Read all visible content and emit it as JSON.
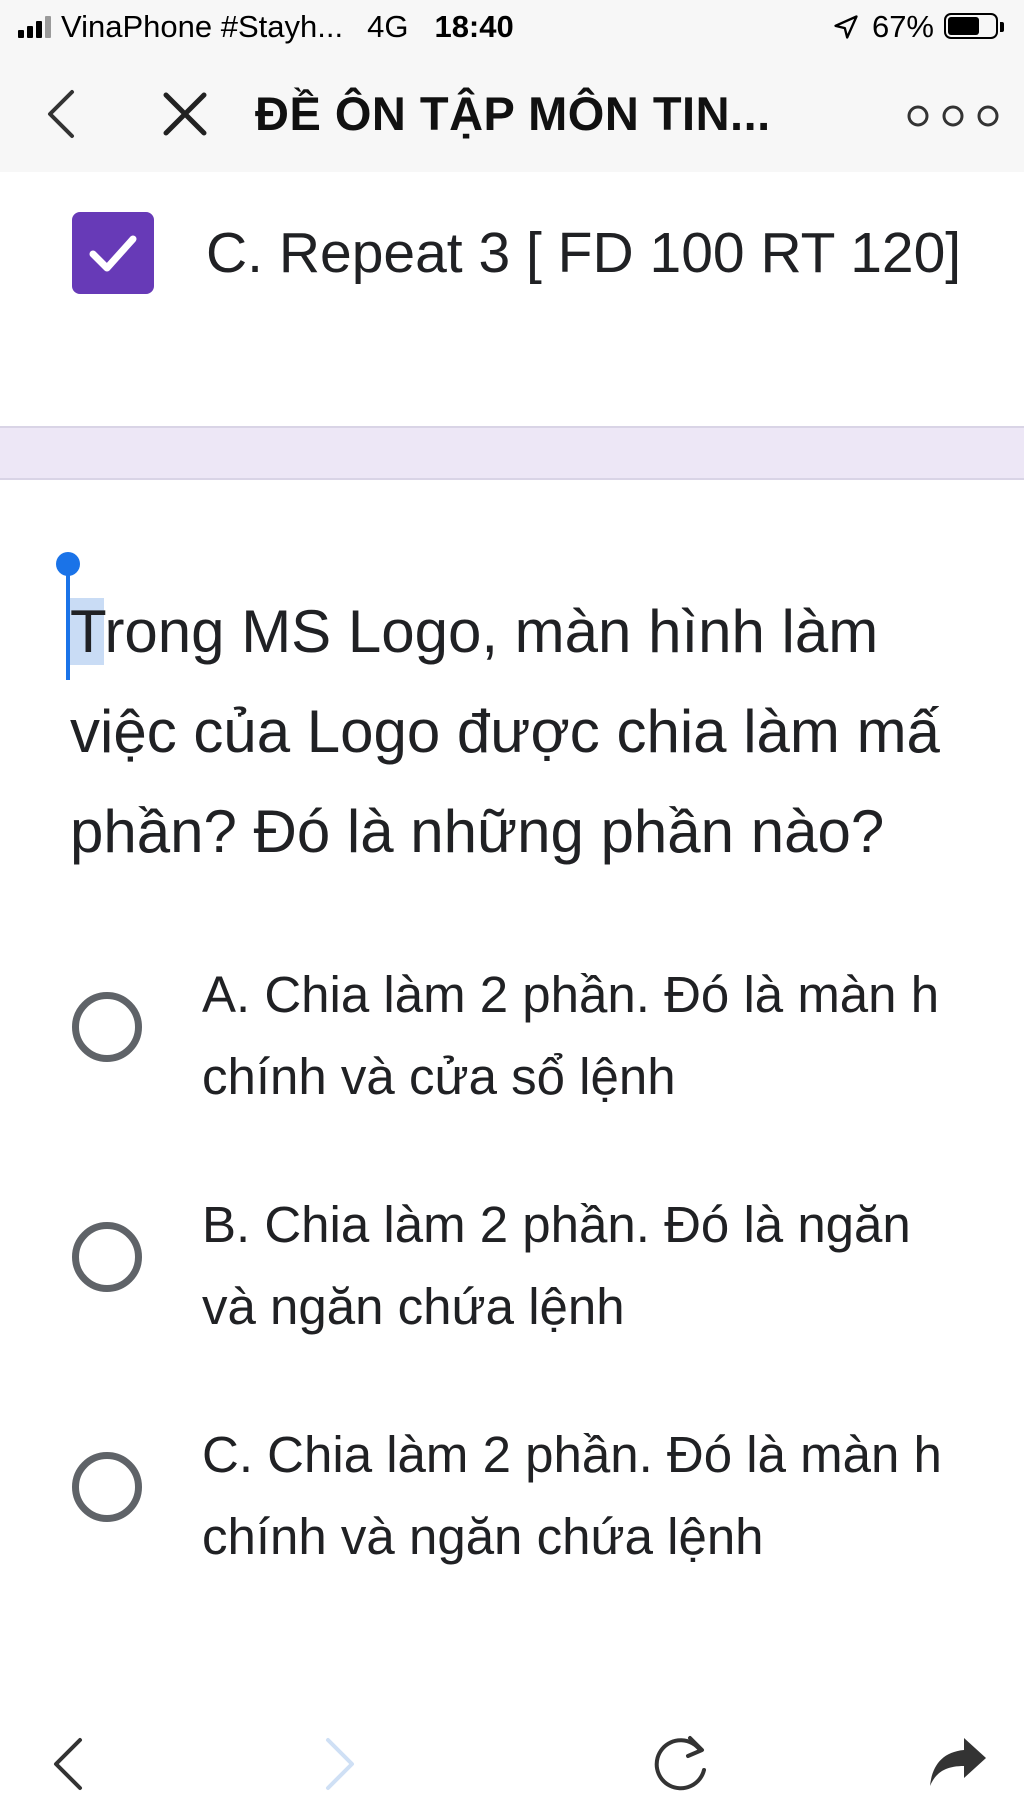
{
  "status_bar": {
    "carrier": "VinaPhone #Stayh...",
    "network": "4G",
    "time": "18:40",
    "battery_percent": "67%",
    "battery_level": 0.67
  },
  "nav": {
    "title": "ĐỀ ÔN TẬP MÔN TIN...",
    "icons": {
      "back": "chevron-left-icon",
      "close": "close-icon",
      "more": "more-dots-icon"
    }
  },
  "content": {
    "checked_option": {
      "label": "C. Repeat 3 [ FD 100 RT 120]",
      "checked": true
    },
    "question": {
      "lines": [
        "Trong MS Logo, màn hình làm",
        "việc của Logo được chia làm mấ",
        "phần? Đó là những phần nào?"
      ],
      "selected_char": "T"
    },
    "options": [
      {
        "lines": [
          "A. Chia làm 2 phần. Đó là màn h",
          "chính và cửa sổ lệnh"
        ]
      },
      {
        "lines": [
          "B. Chia làm 2 phần. Đó là ngăn",
          "và ngăn chứa lệnh"
        ]
      },
      {
        "lines": [
          "C. Chia làm 2 phần. Đó là màn h",
          "chính và ngăn chứa lệnh"
        ]
      }
    ]
  },
  "bottom_bar": {
    "icons": [
      "chevron-left-icon",
      "chevron-right-icon",
      "reload-icon",
      "share-icon"
    ]
  },
  "colors": {
    "accent": "#673ab7",
    "divider": "#ede7f6",
    "selection_handle": "#1a73e8",
    "radio": "#5f6368"
  }
}
